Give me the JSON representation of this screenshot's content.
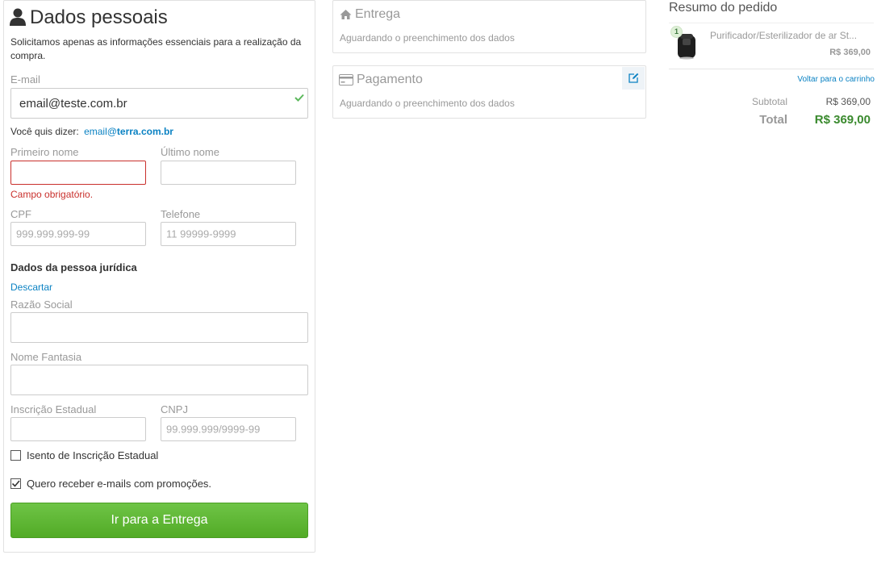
{
  "profile": {
    "title": "Dados pessoais",
    "intro": "Solicitamos apenas as informações essenciais para a realização da compra.",
    "email_label": "E-mail",
    "email_value": "email@teste.com.br",
    "suggestion_prefix": "Você quis dizer:",
    "suggestion_local": "email@",
    "suggestion_domain": "terra.com.br",
    "first_name_label": "Primeiro nome",
    "first_name_value": "",
    "first_name_error": "Campo obrigatório.",
    "last_name_label": "Último nome",
    "last_name_value": "",
    "cpf_label": "CPF",
    "cpf_placeholder": "999.999.999-99",
    "phone_label": "Telefone",
    "phone_placeholder": "11 99999-9999",
    "company_heading": "Dados da pessoa jurídica",
    "discard_label": "Descartar",
    "corporate_name_label": "Razão Social",
    "trade_name_label": "Nome Fantasia",
    "state_registration_label": "Inscrição Estadual",
    "cnpj_label": "CNPJ",
    "cnpj_placeholder": "99.999.999/9999-99",
    "exempt_label": "Isento de Inscrição Estadual",
    "exempt_checked": false,
    "newsletter_label": "Quero receber e-mails com promoções.",
    "newsletter_checked": true,
    "submit_label": "Ir para a Entrega"
  },
  "shipping": {
    "title": "Entrega",
    "status": "Aguardando o preenchimento dos dados",
    "icon": "home-icon"
  },
  "payment": {
    "title": "Pagamento",
    "status": "Aguardando o preenchimento dos dados",
    "icon": "credit-card-icon",
    "edit_icon": "edit-icon"
  },
  "summary": {
    "title": "Resumo do pedido",
    "items": [
      {
        "quantity": "1",
        "name": "Purificador/Esterilizador de ar St...",
        "price": "R$ 369,00"
      }
    ],
    "back_to_cart": "Voltar para o carrinho",
    "subtotal_label": "Subtotal",
    "subtotal_value": "R$ 369,00",
    "total_label": "Total",
    "total_value": "R$ 369,00"
  },
  "colors": {
    "link": "#0b82c3",
    "error": "#c9302c",
    "valid": "#5cb85c",
    "button": "#5cb633",
    "total": "#3a8a2e"
  }
}
